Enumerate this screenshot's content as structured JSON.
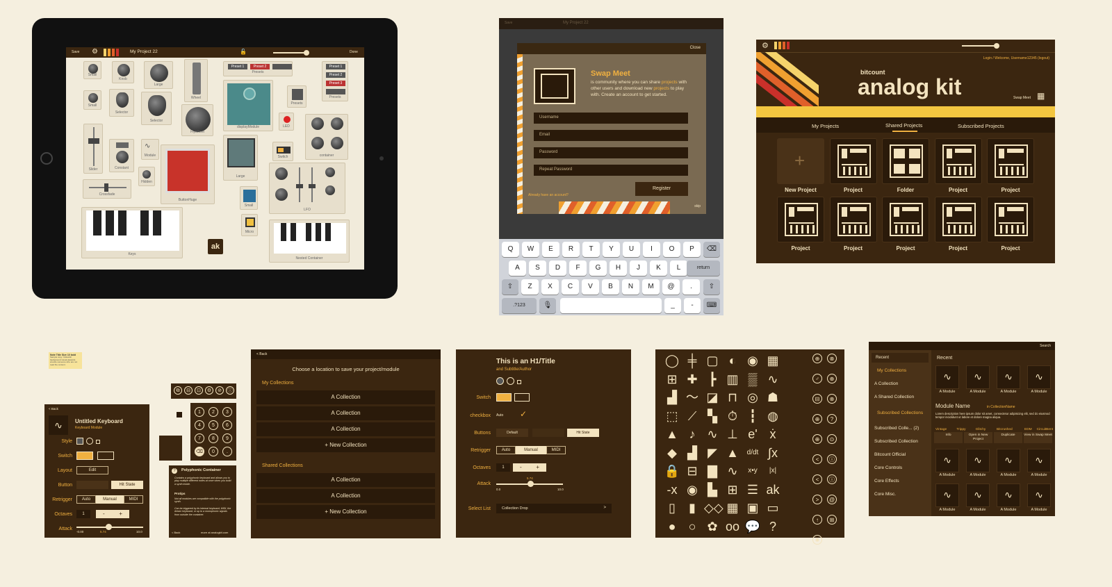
{
  "ipad": {
    "toolbar": {
      "save": "Save",
      "project_title": "My Project 22",
      "done": "Done"
    },
    "widgets": {
      "small1": "Small",
      "knob": "Knob",
      "large": "Large",
      "wheel": "Wheel",
      "presets_row": [
        "Preset 1",
        "Preset 2",
        ""
      ],
      "presets_label": "Presets",
      "preset_col": [
        "Preset 1",
        "Preset 2",
        "Preset 3"
      ],
      "presets_label2": "Presets",
      "small2": "Small",
      "selector1": "Selector",
      "selector2": "Selector",
      "flywheel": "Flywheel",
      "display_module": "displayModule",
      "presets3": "Presets",
      "led": "LED",
      "knobs": [
        "Knob",
        "Knob",
        "Knob",
        "Knob"
      ],
      "container": "container",
      "slider": "Slider",
      "constant": "Constant",
      "module": "Module",
      "switch": "Switch",
      "large2": "Large",
      "button_huge": "ButtonHuge",
      "hidden": "Hidden",
      "crossfade": "Crossfade",
      "small3": "Small",
      "micro": "Micro",
      "volume": "Volume",
      "reverb": "Reverb",
      "bass": "Bass",
      "treble": "Treble",
      "level": "level",
      "output": "output",
      "bitcrush": "bitcrush",
      "lfo": "LFO",
      "keys": "Keys",
      "nested": "Nested Container",
      "ak_logo": "ak"
    }
  },
  "swap": {
    "toolbar_save": "Save",
    "toolbar_title": "My Project 22",
    "close": "Close",
    "title": "Swap Meet",
    "desc_parts": [
      "is community where you can share ",
      "projects",
      " with other users and download new ",
      "projects",
      " to play with. Create an account to get started."
    ],
    "fields": [
      "Username",
      "Email",
      "Password",
      "Repeat Password"
    ],
    "register": "Register",
    "have_account": "Already have an account?",
    "skip": "skip",
    "keyboard": {
      "row1": [
        "Q",
        "W",
        "E",
        "R",
        "T",
        "Y",
        "U",
        "I",
        "O",
        "P"
      ],
      "row2": [
        "A",
        "S",
        "D",
        "F",
        "G",
        "H",
        "J",
        "K",
        "L"
      ],
      "return": "return",
      "row3": [
        "Z",
        "X",
        "C",
        "V",
        "B",
        "N",
        "M",
        "@",
        "."
      ],
      "num": ".?123",
      "underscore": "_",
      "dash": "-"
    }
  },
  "analog": {
    "login": "Login / Welcome, Username12345 (logout)",
    "brand_small": "bitcount",
    "brand": "analog kit",
    "swap_meet": "Swap Meet",
    "tabs": [
      "My Projects",
      "Shared Projects",
      "Subscribed Projects"
    ],
    "row1": [
      "New Project",
      "Project",
      "Folder",
      "Project",
      "Project"
    ],
    "row2": [
      "Project",
      "Project",
      "Project",
      "Project",
      "Project"
    ]
  },
  "note": {
    "title": "Note Title Size 10 bold",
    "body": "Sample copy. Yellowish background visual placards wrestle someone who are not read the content."
  },
  "keyboard_panel": {
    "back": "< Back",
    "title": "Untitled Keyboard",
    "subtitle": "Keyboard Module",
    "labels": [
      "Style",
      "Switch",
      "Layout",
      "Button",
      "Retrigger",
      "Octaves",
      "Attack"
    ],
    "edit": "Edit",
    "hit_state": "Hit State",
    "retrigger": [
      "Auto",
      "Manual",
      "MIDI"
    ],
    "octave_val": "1",
    "attack_min": "-0.00",
    "attack_val": "5.74",
    "attack_max": "10.0"
  },
  "numpad": [
    "1",
    "2",
    "3",
    "4",
    "5",
    "6",
    "7",
    "8",
    "9",
    "",
    "0",
    "."
  ],
  "poly": {
    "title": "Polyphonic Container",
    "body1": "Contains a polyphonic keyboard and allows you to play multiple different notes at once when you build a synth inside.",
    "protips": "Protips",
    "body2": "Not all modules are compatible with the polyphonic synth.",
    "body3": "Can be triggered by its internal keyboard, MIDI, the dream keyboard, or up to a monophonic signals from outside the container.",
    "back": "< Back",
    "more": "more at analogkit.com"
  },
  "save_location": {
    "back": "< Back",
    "title": "Choose a location to save your project/module",
    "my_collections": "My Collections",
    "my_items": [
      "A Collection",
      "A Collection",
      "A Collection",
      "+ New Collection"
    ],
    "shared_collections": "Shared Collections",
    "shared_items": [
      "A Collection",
      "A Collection",
      "+ New Collection"
    ]
  },
  "styleguide": {
    "h1": "This is an H1/Title",
    "subtitle": "and Subtitle/Author",
    "labels": [
      "Switch",
      "checkbox",
      "Buttons",
      "Retrigger",
      "Octaves",
      "Attack",
      "Select List"
    ],
    "auto": "Auto",
    "buttons": [
      "Default",
      "",
      "Hit State"
    ],
    "retrigger": [
      "Auto",
      "Manual",
      "MIDI"
    ],
    "octave_val": "1",
    "attack_val": "5.74",
    "attack_min": "0.0",
    "attack_max": "10.0",
    "select": "Collection Drop",
    "select_arrow": ">"
  },
  "icons": {
    "glyphs": [
      "◯",
      "╪",
      "▢",
      "◐",
      "◉",
      "▦",
      "⊞",
      "✚",
      "┣",
      "▥",
      "▒",
      "∿",
      "▟",
      "〜",
      "◪",
      "⊓",
      "◎",
      "☗",
      "⬚",
      "⟋",
      "▚",
      "⏱",
      "┇",
      "◍",
      "▲",
      "♪",
      "∿",
      "⊥",
      "e'",
      "ẋ",
      "◆",
      "▟",
      "◤",
      "▲",
      "d/dt",
      "∫x",
      "🔒",
      "⊟",
      "▇",
      "∿",
      "x•y",
      "|x|",
      "-x",
      "◉",
      "▙",
      "⊞",
      "☰",
      "ak",
      "▯",
      "▮",
      "◇◇",
      "▦",
      "▣",
      "▭",
      "●",
      "○",
      "✿",
      "oo",
      "💬",
      "?"
    ],
    "side": [
      "⊕",
      "⊗",
      "♂",
      "⊕",
      "⊟",
      "⊗",
      "⊕",
      "?",
      "⊕",
      "⊙",
      "<",
      "ⓘ",
      "<",
      "ⓘ",
      ">",
      "@",
      "↑",
      "⊞",
      "✺"
    ]
  },
  "library": {
    "search": "Search",
    "recent_side": "Recent",
    "my_collections": "My Collections",
    "a_collection": "A Collection",
    "a_shared": "A Shared Collection",
    "subscribed": "Subscribed Collections",
    "sub_items": [
      "Subscribed Colle... (2)",
      "Subscribed Collection",
      "Bitcount Official",
      "Core Controls",
      "Core Effects",
      "Core Misc."
    ],
    "recent_main": "Recent",
    "module_name": "Module Name",
    "in_collection": "in CollectionName",
    "description": "Lorem description here ipsum dolor sit amet, consectetur adipisicing elit, sed do eiusmod tempor incididunt ut labore et dolore magna aliqua.",
    "tags": [
      "Vintage",
      "Trippy",
      "Glitchy",
      "Bitcrushed",
      "EDM",
      "CircuitBent"
    ],
    "actions": [
      "Info",
      "Open in New Project",
      "Duplicate",
      "View in Swap Meet"
    ],
    "module_label": "A Module"
  }
}
